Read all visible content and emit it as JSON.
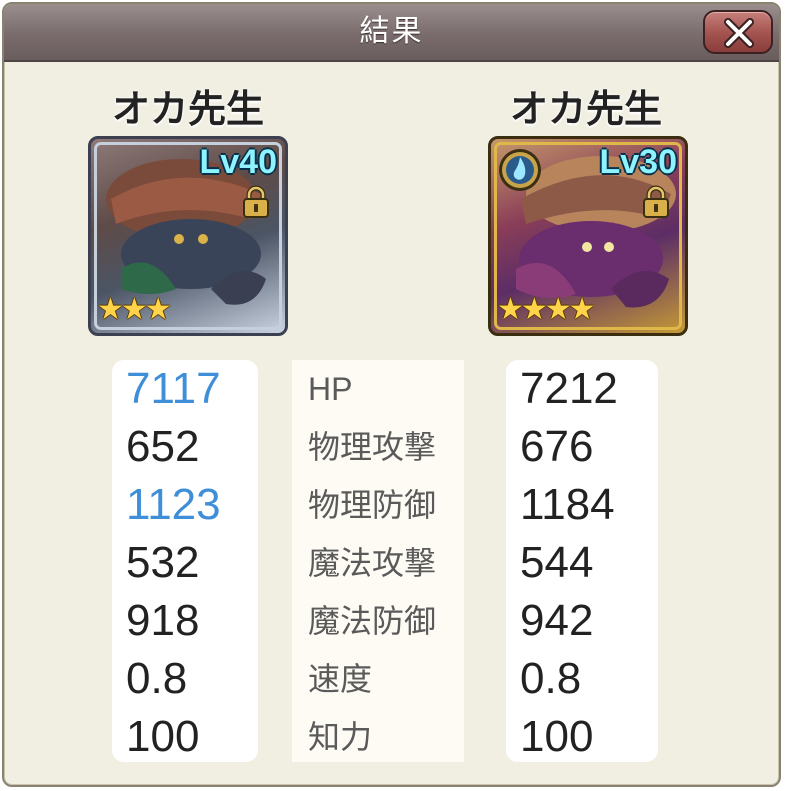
{
  "dialog": {
    "title": "結果"
  },
  "close_button": {
    "icon": "close-icon"
  },
  "units": [
    {
      "name": "オカ先生",
      "level": "Lv40",
      "stars": 3,
      "frame": "silver",
      "locked": true,
      "element_icon": null
    },
    {
      "name": "オカ先生",
      "level": "Lv30",
      "stars": 4,
      "frame": "gold",
      "locked": true,
      "element_icon": "water-element-icon"
    }
  ],
  "stats": {
    "labels": [
      "HP",
      "物理攻撃",
      "物理防御",
      "魔法攻撃",
      "魔法防御",
      "速度",
      "知力"
    ],
    "left": [
      "7117",
      "652",
      "1123",
      "532",
      "918",
      "0.8",
      "100"
    ],
    "right": [
      "7212",
      "676",
      "1184",
      "544",
      "942",
      "0.8",
      "100"
    ],
    "left_highlight_color": "#3f8fd8",
    "left_highlighted": [
      "HP",
      "物理防御"
    ]
  }
}
